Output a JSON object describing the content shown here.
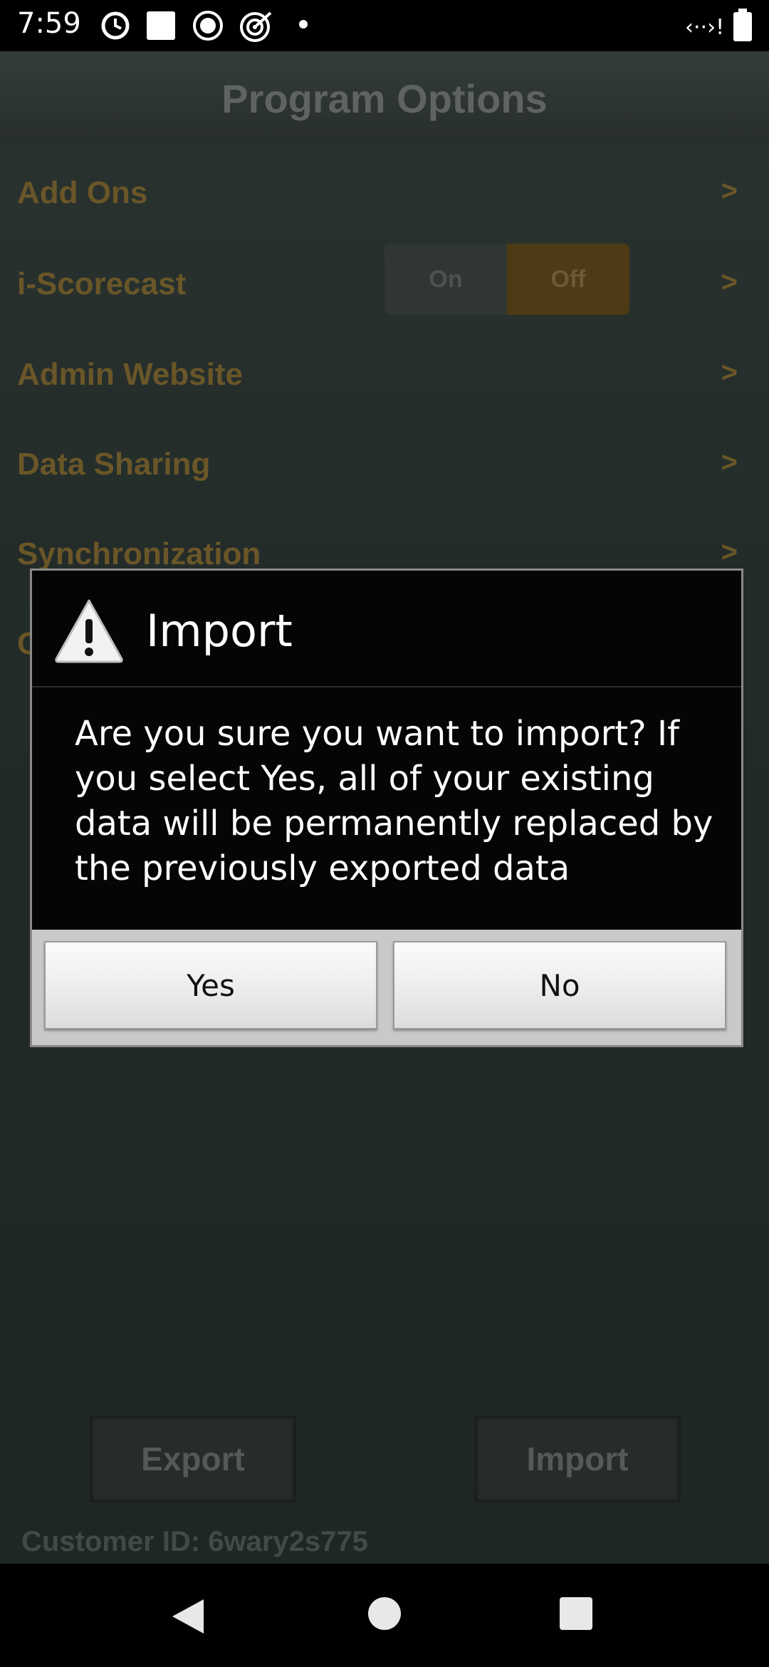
{
  "status_bar": {
    "time": "7:59",
    "left_icons": [
      "moon-icon",
      "square-icon",
      "circle-icon",
      "target-icon",
      "dot-icon"
    ],
    "right_icons": [
      "signal-icon",
      "battery-icon"
    ]
  },
  "header": {
    "title": "Program Options"
  },
  "options": [
    {
      "label": "Add Ons",
      "chevron": ">"
    },
    {
      "label": "i-Scorecast",
      "chevron": ">"
    },
    {
      "label": "Admin Website",
      "chevron": ">"
    },
    {
      "label": "Data Sharing",
      "chevron": ">"
    },
    {
      "label": "Synchronization",
      "chevron": ">"
    },
    {
      "label": "C",
      "chevron": ">"
    }
  ],
  "scorecast_toggle": {
    "on_label": "On",
    "off_label": "Off",
    "selected": "Off"
  },
  "bottom_buttons": {
    "export_label": "Export",
    "import_label": "Import"
  },
  "customer_id": "Customer ID: 6wary2s775",
  "dialog": {
    "title": "Import",
    "message": "Are you sure you want to import? If you select Yes, all of your existing data will be permanently replaced by the previously exported data",
    "yes_label": "Yes",
    "no_label": "No"
  },
  "colors": {
    "accent": "#6a5628",
    "toggle_selected": "#4e3a14",
    "dialog_bg": "#050505"
  }
}
